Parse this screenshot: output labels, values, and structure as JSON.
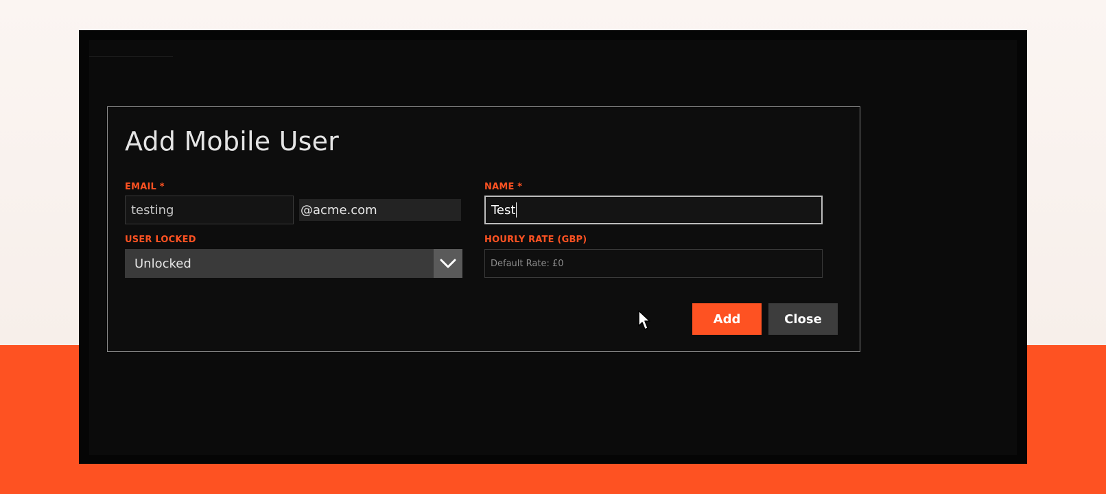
{
  "dialog": {
    "title": "Add Mobile User",
    "email": {
      "label": "EMAIL *",
      "value": "testing",
      "domain": "@acme.com"
    },
    "name": {
      "label": "NAME *",
      "value": "Test"
    },
    "user_locked": {
      "label": "USER LOCKED",
      "selected": "Unlocked"
    },
    "hourly_rate": {
      "label": "HOURLY RATE (GBP)",
      "placeholder": "Default Rate: £0"
    },
    "buttons": {
      "add": "Add",
      "close": "Close"
    }
  },
  "colors": {
    "accent": "#fe5222",
    "background": "#0b0b0b",
    "dialog_border": "#8a8a8a"
  },
  "icons": {
    "select_arrow": "chevron-down-icon",
    "cursor": "mouse-pointer-icon"
  }
}
